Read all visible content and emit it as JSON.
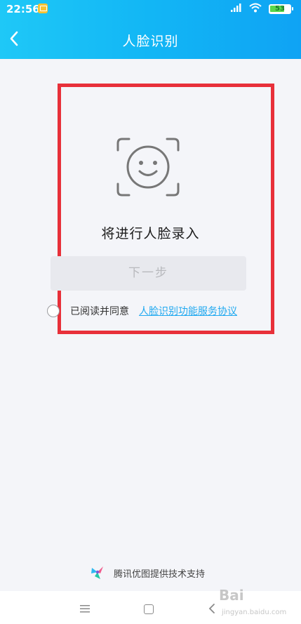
{
  "status_bar": {
    "time": "22:56",
    "battery_level": "53"
  },
  "header": {
    "title": "人脸识别"
  },
  "main": {
    "prompt": "将进行人脸录入",
    "next_button_label": "下一步",
    "agree_text": "已阅读并同意",
    "agreement_link": "人脸识别功能服务协议"
  },
  "footer": {
    "brand_text": "腾讯优图提供技术支持"
  },
  "watermark": {
    "text": "Bai",
    "sub": "jingyan.baidu.com"
  },
  "colors": {
    "header_start": "#1fc8f7",
    "header_end": "#0fa3f4",
    "highlight": "#e8303a",
    "link": "#20a9f0"
  }
}
